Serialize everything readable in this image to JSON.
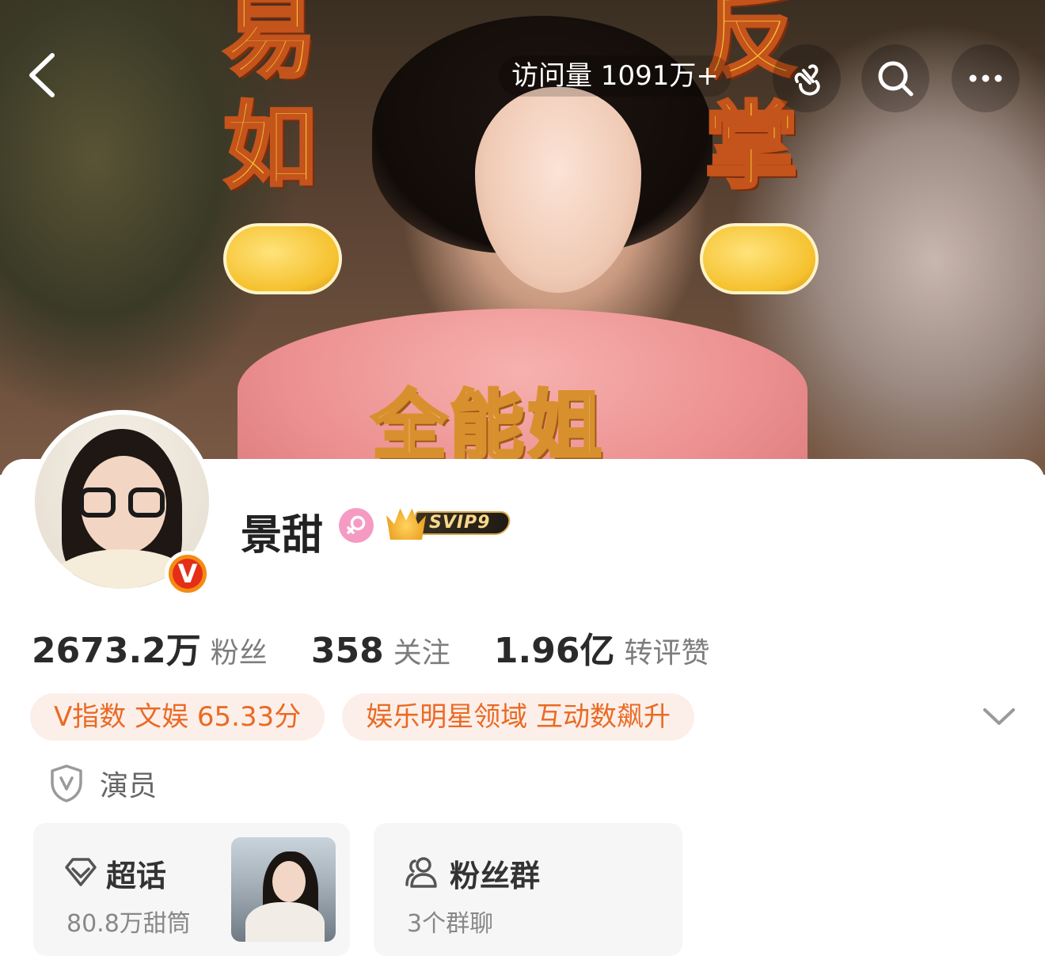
{
  "banner": {
    "left_chars": [
      "易",
      "如"
    ],
    "right_chars": [
      "反",
      "掌"
    ],
    "slogan": "全能姐"
  },
  "topbar": {
    "visits": "访问量 1091万+",
    "icons": [
      "back-arrow-icon",
      "finger-heart-icon",
      "search-icon",
      "more-icon"
    ]
  },
  "profile": {
    "name": "景甜",
    "verified_badge": "V",
    "vip_label": "SVIP9",
    "colors": {
      "accent": "#ea6a24",
      "gender": "#f59bc3",
      "verified": "#f58b12"
    }
  },
  "stats": [
    {
      "value": "2673.2万",
      "label": "粉丝"
    },
    {
      "value": "358",
      "label": "关注"
    },
    {
      "value": "1.96亿",
      "label": "转评赞"
    }
  ],
  "tags": [
    {
      "label": "V指数 文娱 65.33分"
    },
    {
      "label": "娱乐明星领域 互动数飙升"
    }
  ],
  "occupation": "演员",
  "features": {
    "chaohua": {
      "title": "超话",
      "sub": "80.8万甜筒"
    },
    "fan_group": {
      "title": "粉丝群",
      "sub": "3个群聊"
    }
  }
}
